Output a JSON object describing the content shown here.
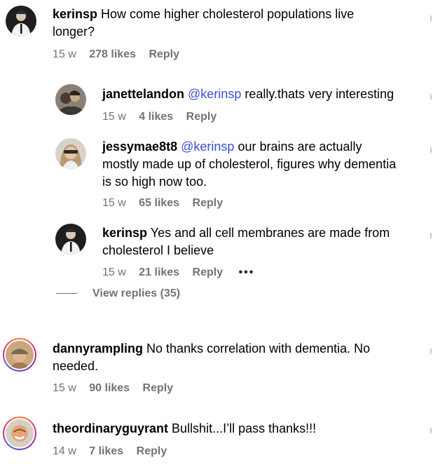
{
  "comments": [
    {
      "username": "kerinsp",
      "mention": "",
      "text": "How come higher cholesterol populations live longer?",
      "time": "15 w",
      "likes": "278 likes",
      "reply": "Reply"
    },
    {
      "username": "janettelandon",
      "mention": "@kerinsp",
      "text": "really.thats very interesting",
      "time": "15 w",
      "likes": "4 likes",
      "reply": "Reply"
    },
    {
      "username": "jessymae8t8",
      "mention": "@kerinsp",
      "text": "our brains are actually mostly made up of cholesterol, figures why dementia is so high now too.",
      "time": "15 w",
      "likes": "65 likes",
      "reply": "Reply"
    },
    {
      "username": "kerinsp",
      "mention": "",
      "text": "Yes and all cell membranes are made from cholesterol I believe",
      "time": "15 w",
      "likes": "21 likes",
      "reply": "Reply",
      "more": "•••"
    },
    {
      "username": "dannyrampling",
      "mention": "",
      "text": "No thanks correlation with dementia. No needed.",
      "time": "15 w",
      "likes": "90 likes",
      "reply": "Reply"
    },
    {
      "username": "theordinaryguyrant",
      "mention": "",
      "text": "Bullshit...I’ll pass thanks!!!",
      "time": "14 w",
      "likes": "7 likes",
      "reply": "Reply"
    }
  ],
  "view_replies": "View replies (35)",
  "colors": {
    "mention": "#3a50d6",
    "meta": "#737373",
    "story_ring": [
      "#f58529",
      "#dd2a7b",
      "#8134af",
      "#515bd4"
    ]
  }
}
